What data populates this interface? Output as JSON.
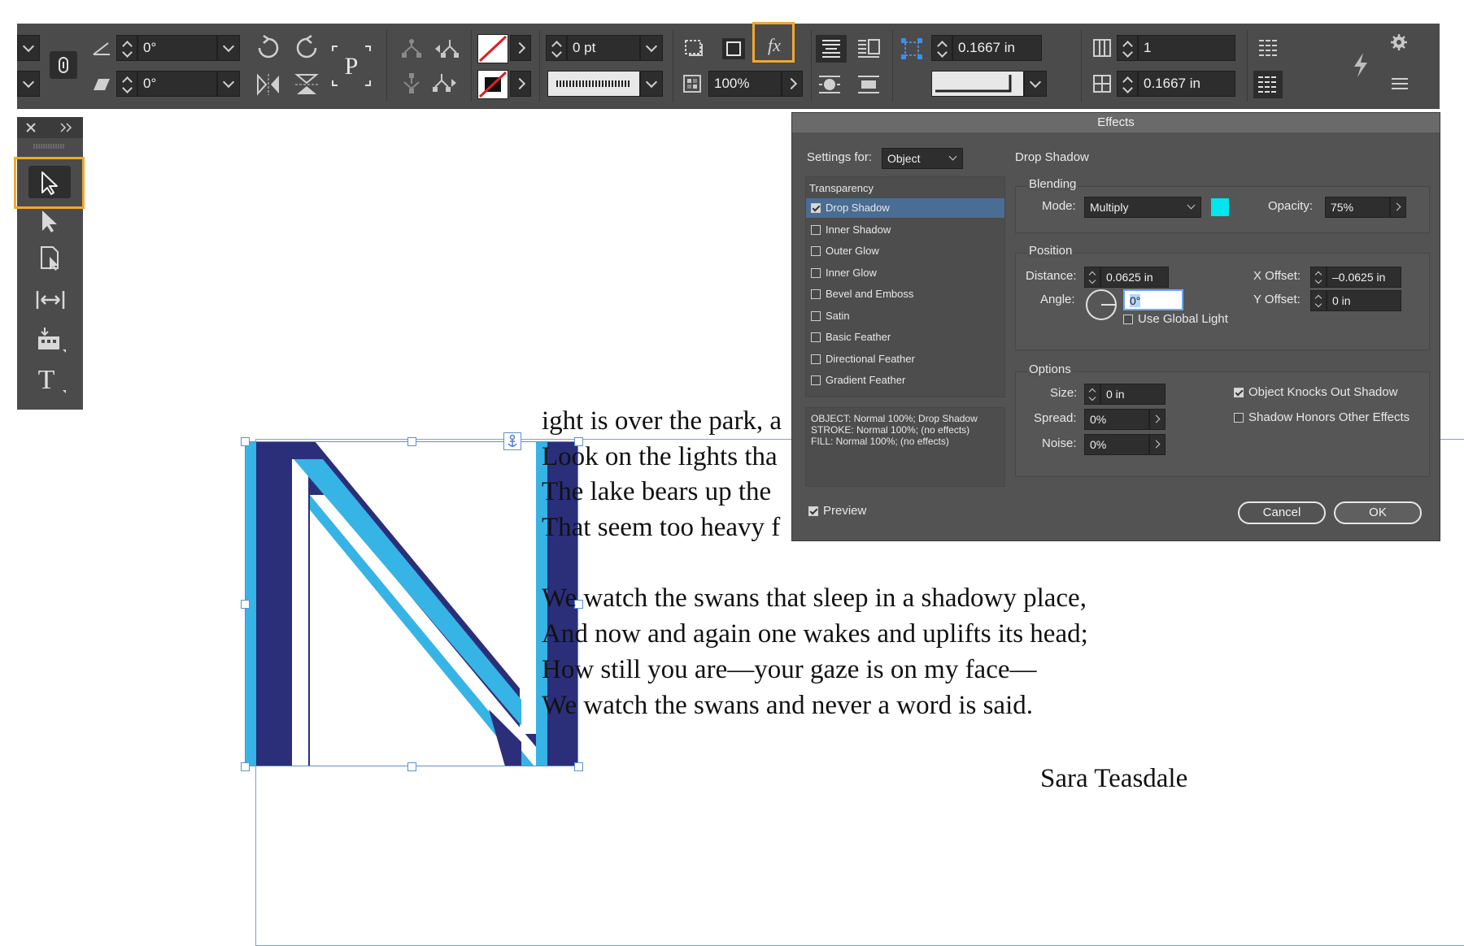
{
  "control_bar": {
    "rotate_angle": "0°",
    "shear_angle": "0°",
    "stroke_weight": "0 pt",
    "opacity": "100%",
    "fx_label": "fx",
    "column_width": "0.1667 in",
    "columns": "1",
    "gutter": "0.1667 in"
  },
  "document": {
    "poem_lines": [
      "ight is over the park, a",
      "Look on the lights tha",
      "The lake bears up the",
      "That seem too heavy f",
      "We watch the swans that sleep in a shadowy place,",
      "And now and again one wakes and uplifts its head;",
      "How still you are—your gaze is on my face—",
      "We watch the swans and never a word is said."
    ],
    "author": "Sara Teasdale",
    "colors": {
      "navy": "#2b2f7a",
      "light_blue": "#36b4e6",
      "guide": "#7a9fd8"
    }
  },
  "effects_dialog": {
    "title": "Effects",
    "settings_for_label": "Settings for:",
    "settings_for_value": "Object",
    "section_title": "Drop Shadow",
    "effect_list_header": "Transparency",
    "effects": [
      {
        "label": "Drop Shadow",
        "checked": true,
        "selected": true
      },
      {
        "label": "Inner Shadow",
        "checked": false
      },
      {
        "label": "Outer Glow",
        "checked": false
      },
      {
        "label": "Inner Glow",
        "checked": false
      },
      {
        "label": "Bevel and Emboss",
        "checked": false
      },
      {
        "label": "Satin",
        "checked": false
      },
      {
        "label": "Basic Feather",
        "checked": false
      },
      {
        "label": "Directional Feather",
        "checked": false
      },
      {
        "label": "Gradient Feather",
        "checked": false
      }
    ],
    "summary": [
      "OBJECT: Normal 100%; Drop Shadow",
      "STROKE: Normal 100%; (no effects)",
      "FILL: Normal 100%; (no effects)"
    ],
    "blending": {
      "title": "Blending",
      "mode_label": "Mode:",
      "mode_value": "Multiply",
      "swatch_color": "#00e5ee",
      "opacity_label": "Opacity:",
      "opacity_value": "75%"
    },
    "position": {
      "title": "Position",
      "distance_label": "Distance:",
      "distance_value": "0.0625 in",
      "angle_label": "Angle:",
      "angle_value": "0°",
      "use_global_light": "Use Global Light",
      "x_offset_label": "X Offset:",
      "x_offset_value": "–0.0625 in",
      "y_offset_label": "Y Offset:",
      "y_offset_value": "0 in"
    },
    "options": {
      "title": "Options",
      "size_label": "Size:",
      "size_value": "0 in",
      "spread_label": "Spread:",
      "spread_value": "0%",
      "noise_label": "Noise:",
      "noise_value": "0%",
      "knocks_out": "Object Knocks Out Shadow",
      "honors_effects": "Shadow Honors Other Effects"
    },
    "preview_label": "Preview",
    "cancel_label": "Cancel",
    "ok_label": "OK"
  },
  "highlight_color": "#f0a830"
}
